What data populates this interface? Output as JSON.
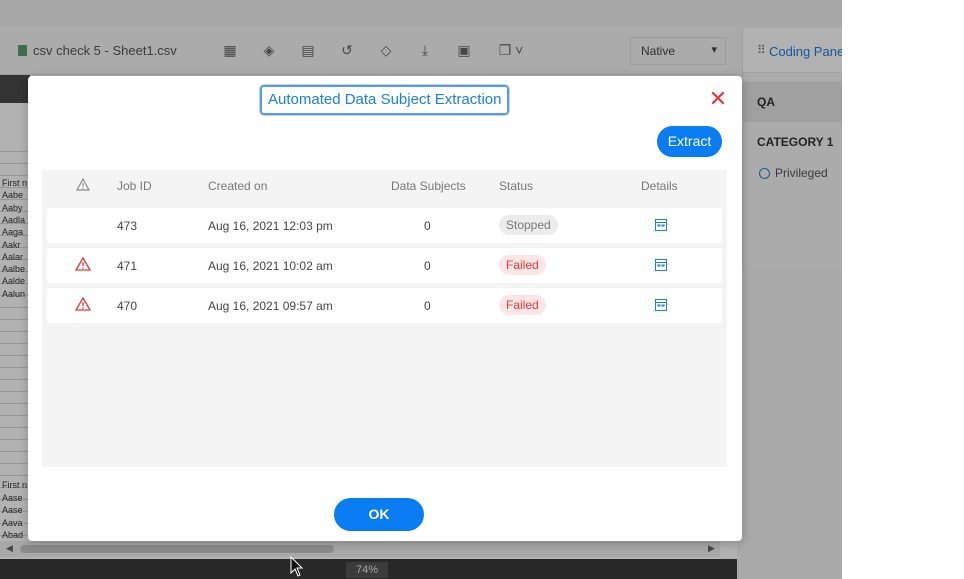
{
  "viewer": {
    "title": "csv check 5 - Sheet1.csv",
    "view_mode": "Native",
    "zoom": "74%",
    "sheet_rows": [
      "First n",
      "Aabe",
      "Aaby",
      "Aadla",
      "Aaga",
      "Aakr",
      "Aalar",
      "Aalbe",
      "Aalde",
      "Aalun"
    ],
    "sheet_rows_bottom": [
      "First n",
      "Aase",
      "Aase",
      "Aava",
      "Abad"
    ]
  },
  "coding_pane": {
    "title": "Coding Pane",
    "section": "QA",
    "category": "CATEGORY 1",
    "option": "Privileged"
  },
  "modal": {
    "title": "Automated Data Subject Extraction",
    "extract_label": "Extract",
    "ok_label": "OK",
    "columns": {
      "job_id": "Job ID",
      "created_on": "Created on",
      "data_subjects": "Data Subjects",
      "status": "Status",
      "details": "Details"
    },
    "jobs": [
      {
        "warning": false,
        "job_id": "473",
        "created_on": "Aug 16, 2021 12:03 pm",
        "data_subjects": "0",
        "status": "Stopped"
      },
      {
        "warning": true,
        "job_id": "471",
        "created_on": "Aug 16, 2021 10:02 am",
        "data_subjects": "0",
        "status": "Failed"
      },
      {
        "warning": true,
        "job_id": "470",
        "created_on": "Aug 16, 2021 09:57 am",
        "data_subjects": "0",
        "status": "Failed"
      }
    ]
  },
  "colors": {
    "primary": "#0a7cf1",
    "danger": "#e53935",
    "failed_bg": "#fde5e5",
    "stopped_bg": "#ececec"
  }
}
